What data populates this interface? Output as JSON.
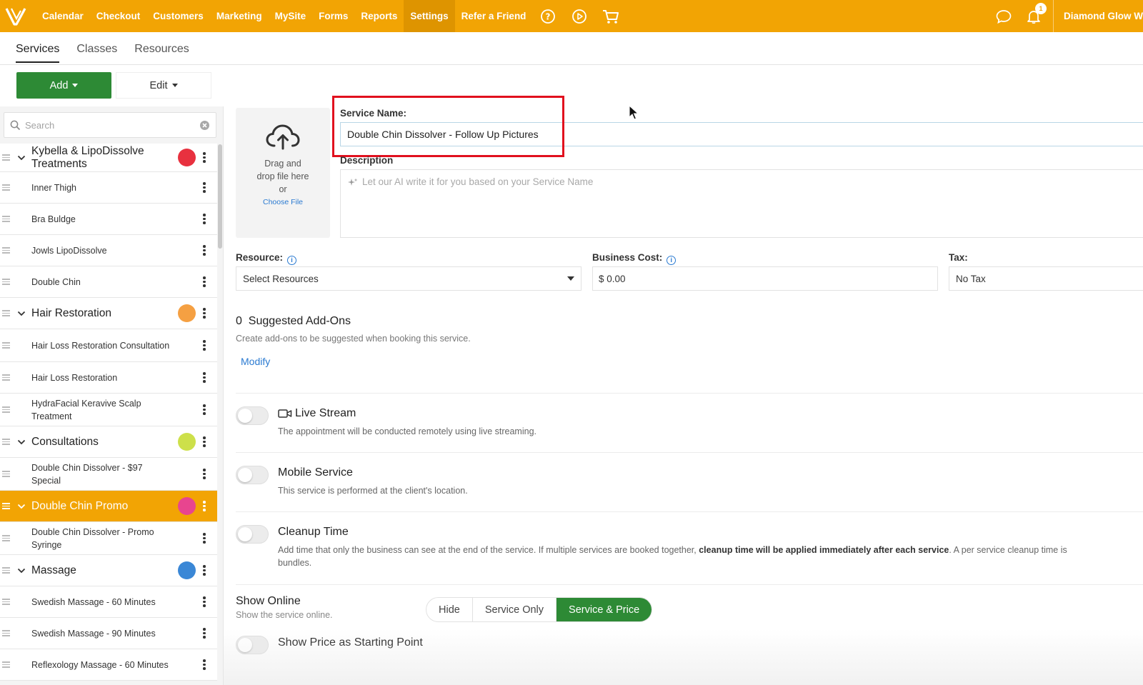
{
  "nav": {
    "items": [
      "Calendar",
      "Checkout",
      "Customers",
      "Marketing",
      "MySite",
      "Forms",
      "Reports",
      "Settings",
      "Refer a Friend"
    ],
    "active": "Settings",
    "notifications_count": "1",
    "account_name": "Diamond Glow W"
  },
  "subtabs": [
    "Services",
    "Classes",
    "Resources"
  ],
  "toolbar": {
    "add_label": "Add",
    "edit_label": "Edit"
  },
  "sidebar": {
    "search_placeholder": "Search",
    "rows": [
      {
        "type": "cat",
        "label": "Kybella & LipoDissolve Treatments",
        "color": "#e8313f"
      },
      {
        "type": "item",
        "label": "Inner Thigh"
      },
      {
        "type": "item",
        "label": "Bra Buldge"
      },
      {
        "type": "item",
        "label": "Jowls LipoDissolve"
      },
      {
        "type": "item",
        "label": "Double Chin"
      },
      {
        "type": "cat",
        "label": "Hair Restoration",
        "color": "#f5a042"
      },
      {
        "type": "item",
        "label": "Hair Loss Restoration Consultation"
      },
      {
        "type": "item",
        "label": "Hair Loss Restoration"
      },
      {
        "type": "item",
        "label": "HydraFacial Keravive Scalp Treatment"
      },
      {
        "type": "cat",
        "label": "Consultations",
        "color": "#cde04a"
      },
      {
        "type": "item",
        "label": "Double Chin Dissolver - $97 Special"
      },
      {
        "type": "cat",
        "label": "Double Chin Promo",
        "color": "#e8458f",
        "selected": true
      },
      {
        "type": "item",
        "label": "Double Chin Dissolver - Promo Syringe"
      },
      {
        "type": "cat",
        "label": "Massage",
        "color": "#3a87d6"
      },
      {
        "type": "item",
        "label": "Swedish Massage - 60 Minutes"
      },
      {
        "type": "item",
        "label": "Swedish Massage - 90 Minutes"
      },
      {
        "type": "item",
        "label": "Reflexology Massage - 60 Minutes"
      }
    ]
  },
  "upload": {
    "line1": "Drag and",
    "line2": "drop file here",
    "line3": "or",
    "choose": "Choose File"
  },
  "form": {
    "service_name_label": "Service Name:",
    "service_name_value": "Double Chin Dissolver - Follow Up Pictures",
    "description_label": "Description",
    "description_placeholder": "Let our AI write it for you based on your Service Name",
    "resource_label": "Resource:",
    "resource_value": "Select Resources",
    "cost_label": "Business Cost:",
    "cost_value": "$ 0.00",
    "tax_label": "Tax:",
    "tax_value": "No Tax"
  },
  "addons": {
    "count": "0",
    "title": "Suggested Add-Ons",
    "subtitle": "Create add-ons to be suggested when booking this service.",
    "modify": "Modify"
  },
  "options": {
    "live_title": "Live Stream",
    "live_sub": "The appointment will be conducted remotely using live streaming.",
    "mobile_title": "Mobile Service",
    "mobile_sub": "This service is performed at the client's location.",
    "cleanup_title": "Cleanup Time",
    "cleanup_sub_a": "Add time that only the business can see at the end of the service. If multiple services are booked together, ",
    "cleanup_sub_b": "cleanup time will be applied immediately after each service",
    "cleanup_sub_c": ". A per service cleanup time is",
    "cleanup_sub_d": "bundles.",
    "show_online_title": "Show Online",
    "show_online_sub": "Show the service online.",
    "show_online_options": [
      "Hide",
      "Service Only",
      "Service & Price"
    ],
    "show_online_selected": "Service & Price",
    "starting_price_title": "Show Price as Starting Point"
  }
}
